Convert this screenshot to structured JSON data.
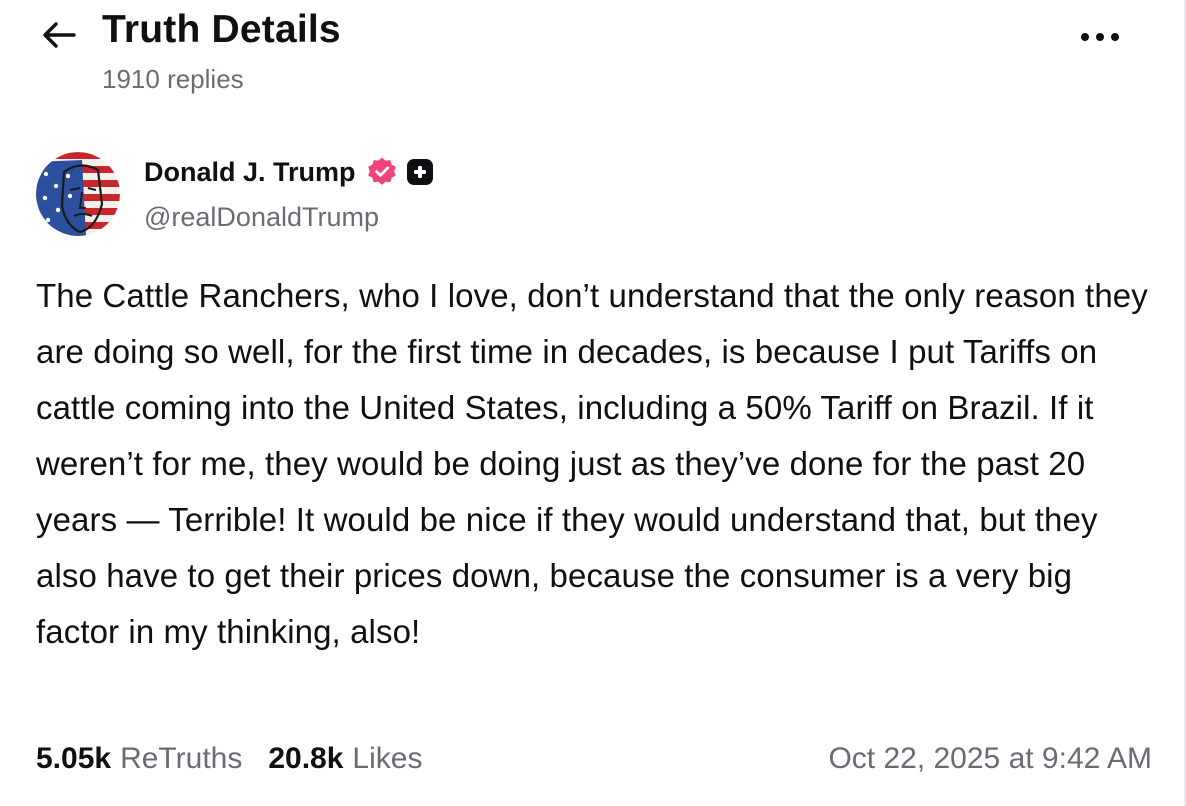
{
  "header": {
    "title": "Truth Details",
    "replies": "1910 replies",
    "back_icon": "arrow-left-icon",
    "more_icon": "more-horizontal-icon"
  },
  "author": {
    "name": "Donald J. Trump",
    "handle": "@realDonaldTrump",
    "verified_badge_color": "#f0437a",
    "plus_badge_color": "#0f0f14"
  },
  "post": {
    "text": "The Cattle Ranchers, who I love, don’t understand that the only reason they are doing so well, for the first time in decades, is because I put Tariffs on cattle coming into the United States, including a 50% Tariff on Brazil. If it weren’t for me, they would be doing just as they’ve done for the past 20 years — Terrible! It would be nice if they would understand that, but they also have to get their prices down, because the consumer is a very big factor in my thinking, also!"
  },
  "stats": {
    "retruths_count": "5.05k",
    "retruths_label": "ReTruths",
    "likes_count": "20.8k",
    "likes_label": "Likes",
    "timestamp": "Oct 22, 2025 at 9:42 AM"
  },
  "colors": {
    "text_primary": "#0f0f14",
    "text_secondary": "#6b6b76",
    "divider": "#e9e9ee"
  }
}
